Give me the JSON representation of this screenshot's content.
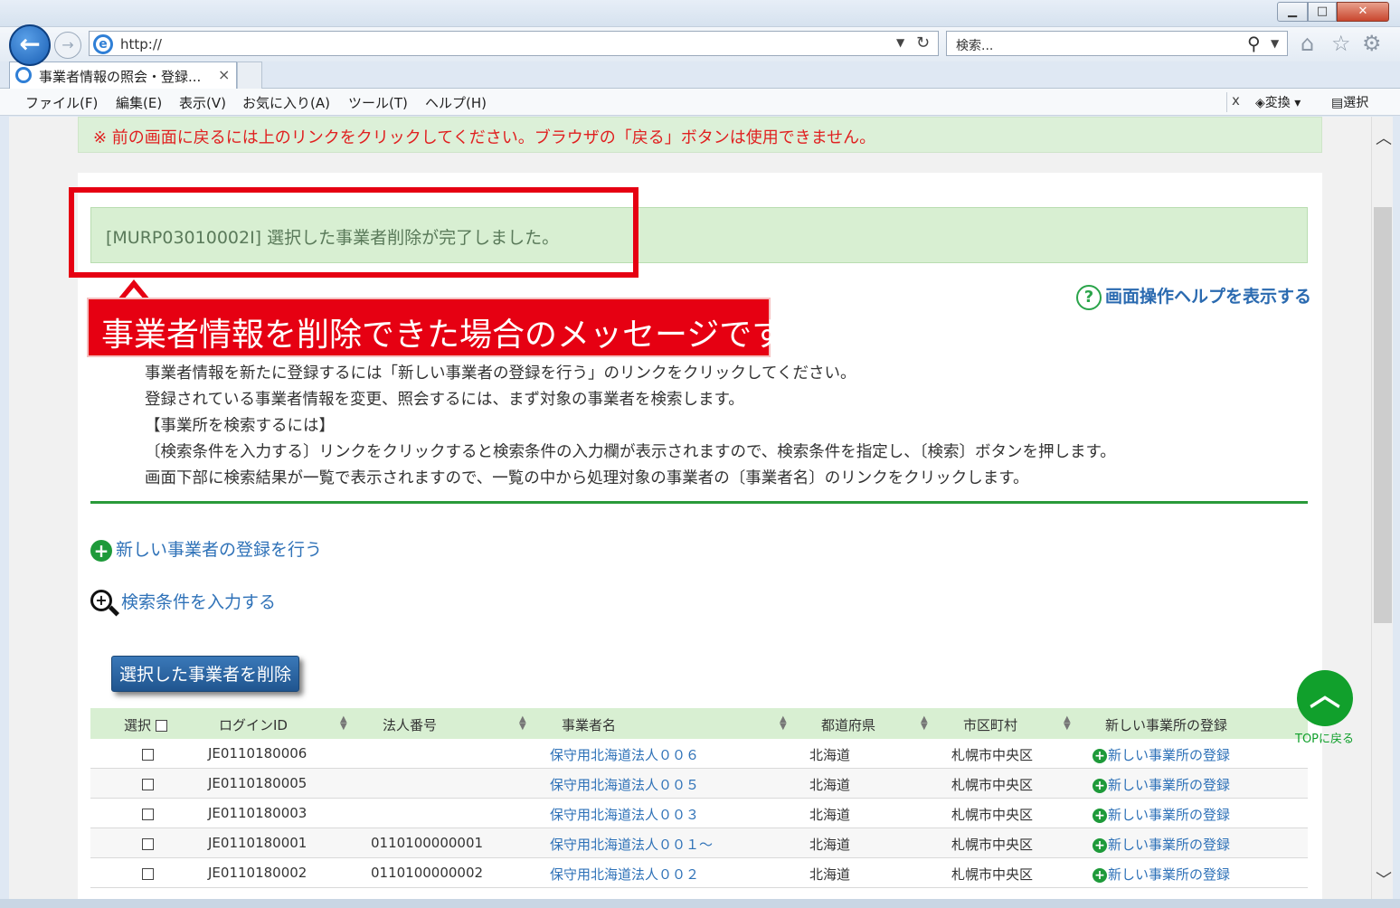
{
  "browser": {
    "url": "http://",
    "search_placeholder": "検索...",
    "tab_title": "事業者情報の照会・登録...",
    "tab_close": "×",
    "menu": [
      "ファイル(F)",
      "編集(E)",
      "表示(V)",
      "お気に入り(A)",
      "ツール(T)",
      "ヘルプ(H)"
    ],
    "toolbar_close": "x",
    "toolbar_convert": "変換",
    "toolbar_select": "選択"
  },
  "page": {
    "warning": "※ 前の画面に戻るには上のリンクをクリックしてください。ブラウザの「戻る」ボタンは使用できません。",
    "message": "[MURP03010002I] 選択した事業者削除が完了しました。",
    "callout": "事業者情報を削除できた場合のメッセージです。",
    "help_link": "画面操作ヘルプを表示する",
    "instructions": [
      "事業者情報を新たに登録するには「新しい事業者の登録を行う」のリンクをクリックしてください。",
      "登録されている事業者情報を変更、照会するには、まず対象の事業者を検索します。",
      "【事業所を検索するには】",
      "〔検索条件を入力する〕リンクをクリックすると検索条件の入力欄が表示されますので、検索条件を指定し、〔検索〕ボタンを押します。",
      "画面下部に検索結果が一覧で表示されますので、一覧の中から処理対象の事業者の〔事業者名〕のリンクをクリックします。"
    ],
    "new_operator_link": "新しい事業者の登録を行う",
    "search_conditions_link": "検索条件を入力する",
    "delete_button": "選択した事業者を削除",
    "top_label": "TOPに戻る"
  },
  "table": {
    "headers": {
      "select": "選択",
      "login_id": "ログインID",
      "corp_no": "法人番号",
      "name": "事業者名",
      "prefecture": "都道府県",
      "city": "市区町村",
      "new_office": "新しい事業所の登録"
    },
    "rows": [
      {
        "login_id": "JE0110180006",
        "corp_no": "",
        "name": "保守用北海道法人００６",
        "prefecture": "北海道",
        "city": "札幌市中央区",
        "link": "新しい事業所の登録"
      },
      {
        "login_id": "JE0110180005",
        "corp_no": "",
        "name": "保守用北海道法人００５",
        "prefecture": "北海道",
        "city": "札幌市中央区",
        "link": "新しい事業所の登録"
      },
      {
        "login_id": "JE0110180003",
        "corp_no": "",
        "name": "保守用北海道法人００３",
        "prefecture": "北海道",
        "city": "札幌市中央区",
        "link": "新しい事業所の登録"
      },
      {
        "login_id": "JE0110180001",
        "corp_no": "0110100000001",
        "name": "保守用北海道法人００１～",
        "prefecture": "北海道",
        "city": "札幌市中央区",
        "link": "新しい事業所の登録"
      },
      {
        "login_id": "JE0110180002",
        "corp_no": "0110100000002",
        "name": "保守用北海道法人００２",
        "prefecture": "北海道",
        "city": "札幌市中央区",
        "link": "新しい事業所の登録"
      }
    ]
  }
}
